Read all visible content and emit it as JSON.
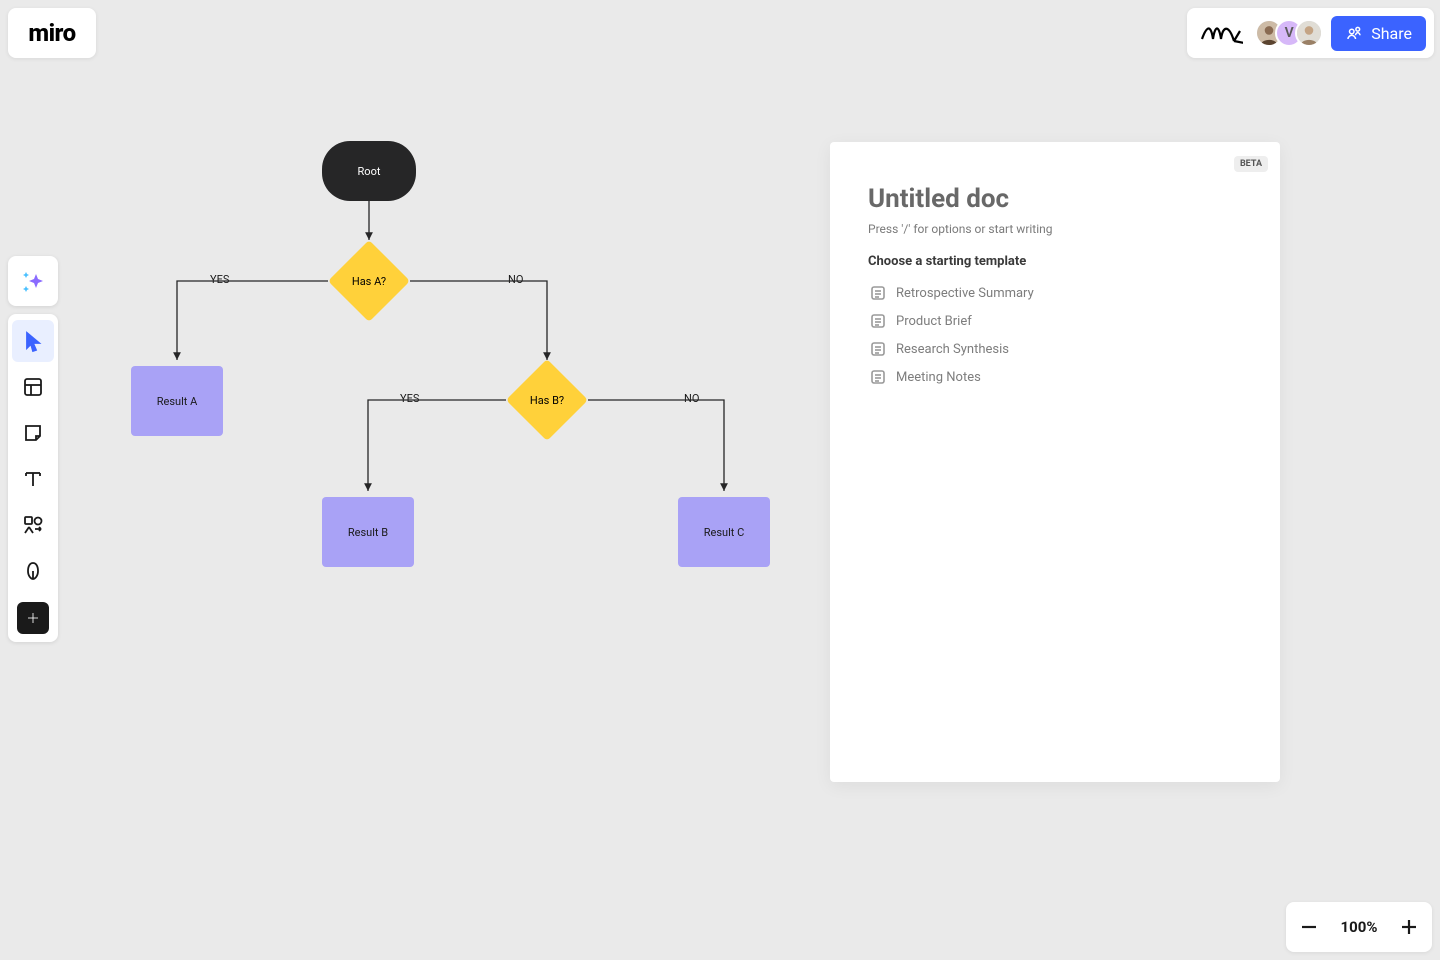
{
  "logo": "miro",
  "share": {
    "label": "Share"
  },
  "avatars": {
    "middle_initial": "V"
  },
  "zoom": {
    "value": "100%"
  },
  "flow": {
    "root": "Root",
    "q1": "Has A?",
    "q2": "Has B?",
    "resA": "Result A",
    "resB": "Result B",
    "resC": "Result C",
    "yes1": "YES",
    "no1": "NO",
    "yes2": "YES",
    "no2": "NO"
  },
  "doc": {
    "beta": "BETA",
    "title": "Untitled doc",
    "hint": "Press '/' for options or start writing",
    "choose": "Choose a starting template",
    "templates": {
      "t1": "Retrospective Summary",
      "t2": "Product Brief",
      "t3": "Research Synthesis",
      "t4": "Meeting Notes"
    }
  }
}
